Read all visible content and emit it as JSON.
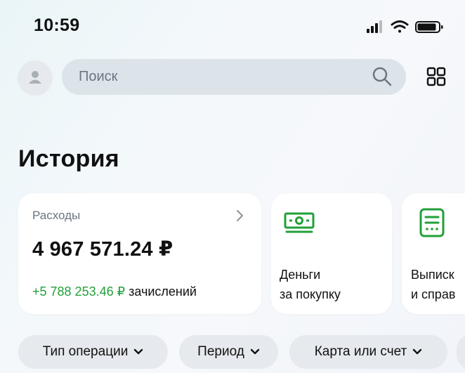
{
  "status_bar": {
    "time": "10:59"
  },
  "search": {
    "placeholder": "Поиск"
  },
  "page": {
    "title": "История"
  },
  "expenses_card": {
    "label": "Расходы",
    "amount": "4 967 571.24 ₽",
    "income_amount": "+5 788 253.46 ₽",
    "income_suffix": " зачислений"
  },
  "quick_cards": [
    {
      "line1": "Деньги",
      "line2": "за покупку",
      "icon": "cash-icon"
    },
    {
      "line1": "Выписк",
      "line2": "и справ",
      "icon": "document-icon"
    }
  ],
  "filters": [
    {
      "label": "Тип операции"
    },
    {
      "label": "Период"
    },
    {
      "label": "Карта или счет"
    }
  ],
  "colors": {
    "accent_green": "#21a038",
    "chip_bg": "#e6e9ed",
    "search_bg": "#dce4ea"
  }
}
